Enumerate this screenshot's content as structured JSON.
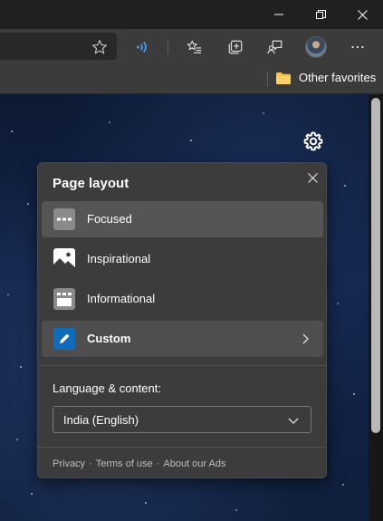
{
  "colors": {
    "accent_blue": "#0f6cbd",
    "signal_blue": "#4ea3ff",
    "panel_bg": "#3c3c3c",
    "favorites_folder": "#f2c14e"
  },
  "titlebar": {
    "icons": [
      "minimize-icon",
      "restore-icon",
      "close-icon"
    ]
  },
  "toolbar": {
    "icons": [
      "favorite-star-icon",
      "read-aloud-icon",
      "favorites-icon",
      "collections-icon",
      "feedback-icon",
      "profile-avatar",
      "more-options-icon"
    ]
  },
  "favorites_bar": {
    "other_favorites_label": "Other favorites"
  },
  "panel": {
    "title": "Page layout",
    "options": [
      {
        "label": "Focused",
        "selected": true,
        "icon": "focused-layout-icon"
      },
      {
        "label": "Inspirational",
        "selected": false,
        "icon": "inspirational-layout-icon"
      },
      {
        "label": "Informational",
        "selected": false,
        "icon": "informational-layout-icon"
      },
      {
        "label": "Custom",
        "selected": false,
        "icon": "custom-pencil-icon"
      }
    ],
    "language_label": "Language & content:",
    "language_value": "India (English)",
    "footer": {
      "privacy": "Privacy",
      "terms": "Terms of use",
      "ads": "About our Ads",
      "separator": "·"
    }
  }
}
